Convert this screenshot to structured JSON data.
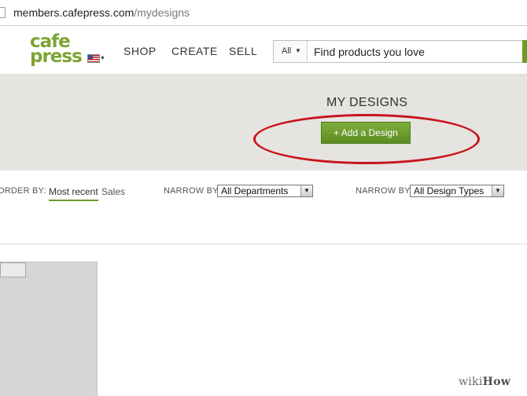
{
  "browser": {
    "url_host": "members.cafepress.com",
    "url_path": "/mydesigns",
    "page_icon": "page-icon"
  },
  "header": {
    "logo_line1": "cafe",
    "logo_line2": "press",
    "locale_flag": "us-flag-icon",
    "nav": {
      "shop": "SHOP",
      "create": "CREATE",
      "sell": "SELL"
    },
    "search": {
      "category": "All",
      "placeholder": "Find products you love"
    }
  },
  "banner": {
    "title": "MY DESIGNS",
    "add_button": "+ Add a Design"
  },
  "filters": {
    "order_by_label": "ORDER BY:",
    "order_options": [
      "Most recent",
      "Sales"
    ],
    "selected_order": "Most recent",
    "narrow1_label": "NARROW BY:",
    "narrow1_value": "All Departments",
    "narrow2_label": "NARROW BY:",
    "narrow2_value": "All Design Types"
  },
  "watermark": {
    "prefix": "wiki",
    "suffix": "How"
  },
  "colors": {
    "brand_green": "#7aa532",
    "button_green": "#6e9a2a",
    "highlight_red": "#c8141c",
    "banner_gray": "#e6e4e1"
  }
}
